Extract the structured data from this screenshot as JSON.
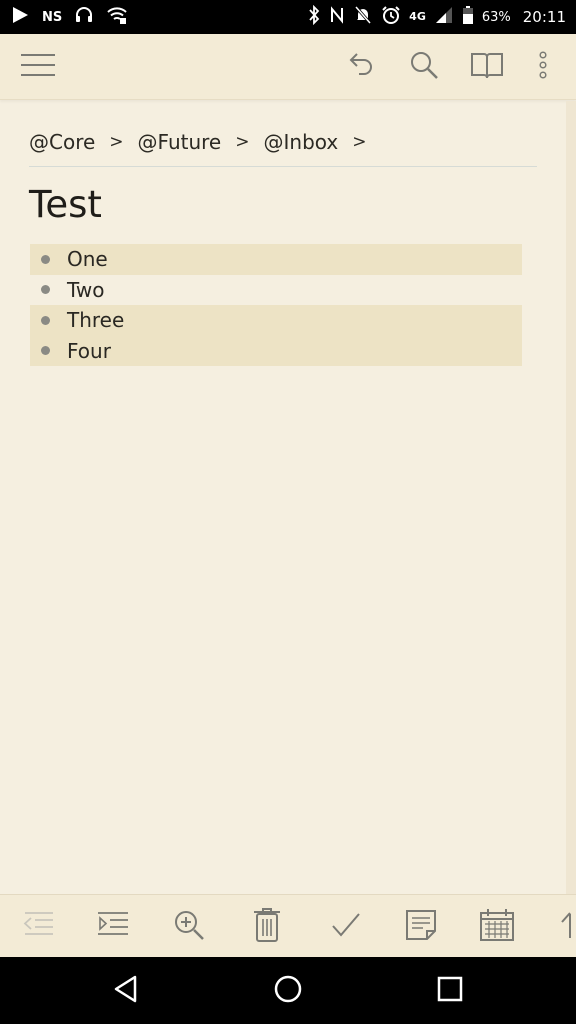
{
  "status_bar": {
    "carrier": "NS",
    "network": "4G",
    "battery": "63%",
    "time": "20:11"
  },
  "breadcrumb": {
    "items": [
      "@Core",
      "@Future",
      "@Inbox"
    ],
    "separator": ">"
  },
  "document": {
    "title": "Test",
    "items": [
      {
        "text": "One",
        "highlighted": true
      },
      {
        "text": "Two",
        "highlighted": false
      },
      {
        "text": "Three",
        "highlighted": true
      },
      {
        "text": "Four",
        "highlighted": true
      }
    ]
  },
  "icons": {
    "appbar": [
      "menu-icon",
      "undo-icon",
      "search-icon",
      "book-icon",
      "more-vert-icon"
    ],
    "toolbar": [
      "outdent-icon",
      "indent-icon",
      "zoom-in-icon",
      "delete-icon",
      "check-icon",
      "note-icon",
      "calendar-icon",
      "arrow-up-icon"
    ],
    "navbar": [
      "back-icon",
      "home-icon",
      "recents-icon"
    ]
  },
  "colors": {
    "background": "#f5efe0",
    "bar": "#f3ebd6",
    "highlight": "#ede3c5",
    "icon": "#7a7a74"
  }
}
